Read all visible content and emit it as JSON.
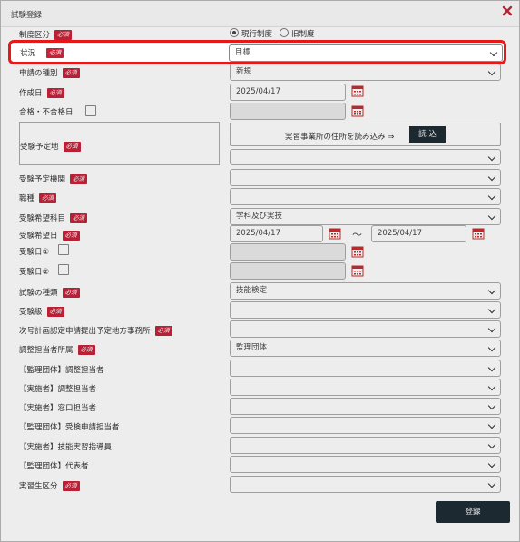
{
  "dialog": {
    "title": "試験登録"
  },
  "system": {
    "label": "制度区分",
    "options": [
      "現行制度",
      "旧制度"
    ]
  },
  "status": {
    "label": "状況",
    "value": "目標"
  },
  "application_type": {
    "label": "申請の種別",
    "value": "新規"
  },
  "created_date": {
    "label": "作成日",
    "value": "2025/04/17"
  },
  "pass_date": {
    "label": "合格・不合格日",
    "value": ""
  },
  "exam_location": {
    "label": "受験予定地",
    "load_text": "実習事業所の住所を読み込み ⇒",
    "load_button": "読 込",
    "value": ""
  },
  "exam_org": {
    "label": "受験予定機関",
    "value": ""
  },
  "job_type": {
    "label": "職種",
    "value": ""
  },
  "exam_subject": {
    "label": "受験希望科目",
    "value": "学科及び実技"
  },
  "exam_desired_date": {
    "label": "受験希望日",
    "from": "2025/04/17",
    "separator": "〜",
    "to": "2025/04/17"
  },
  "exam_date1": {
    "label": "受験日①",
    "value": ""
  },
  "exam_date2": {
    "label": "受験日②",
    "value": ""
  },
  "exam_type": {
    "label": "試験の種類",
    "value": "技能検定"
  },
  "exam_grade": {
    "label": "受験級",
    "value": ""
  },
  "submission_office": {
    "label": "次号計画認定申請提出予定地方事務所",
    "value": ""
  },
  "coordinator_affiliation": {
    "label": "調整担当者所属",
    "value": "監理団体"
  },
  "supervising_coordinator": {
    "label": "【監理団体】調整担当者",
    "value": ""
  },
  "implementer_coordinator": {
    "label": "【実施者】調整担当者",
    "value": ""
  },
  "implementer_contact": {
    "label": "【実施者】窓口担当者",
    "value": ""
  },
  "supervising_exam_applicant": {
    "label": "【監理団体】受検申請担当者",
    "value": ""
  },
  "implementer_instructor": {
    "label": "【実施者】技能実習指導員",
    "value": ""
  },
  "supervising_representative": {
    "label": "【監理団体】代表者",
    "value": ""
  },
  "trainee_category": {
    "label": "実習生区分",
    "value": ""
  },
  "footer": {
    "register_button": "登録"
  },
  "badges": {
    "required": "必須"
  },
  "colors": {
    "required_badge": "#c8223a",
    "focus_border": "#e81818",
    "dark_button": "#1f2d35",
    "calendar_icon": "#c43030"
  }
}
